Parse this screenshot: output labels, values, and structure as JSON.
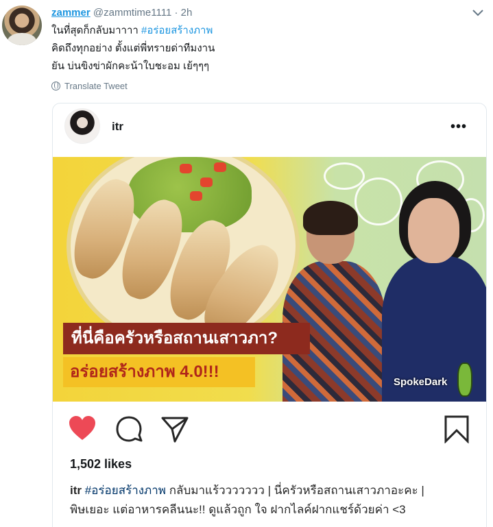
{
  "tweet": {
    "display_name": "zammer",
    "handle": "@zammtime1111",
    "separator": "·",
    "time": "2h",
    "line1_text": "ในที่สุดก็กลับมาาาา ",
    "line1_hashtag": "#อร่อยสร้างภาพ",
    "line2": "คิดถึงทุกอย่าง ตั้งแต่พี่ทรายด่าทีมงาน",
    "line3": "ยัน บ่นขิงข่าผักคะน้าใบชะอม เย้ๆๆๆ",
    "translate_label": "Translate Tweet"
  },
  "embed": {
    "username": "itr",
    "more_label": "•••",
    "image_banner_line1": "ที่นี่คือครัวหรือสถานเสาวภา?",
    "image_banner_line2": "อร่อยสร้างภาพ 4.0!!!",
    "image_brand": "SpokeDark",
    "likes": "1,502 likes",
    "caption_user": "itr",
    "caption_hashtag": "#อร่อยสร้างภาพ",
    "caption_line1_rest": " กลับมาแร้ววววววว | นี่ครัวหรือสถานเสาวภาอะคะ |",
    "caption_line2": "พิษเยอะ แต่อาหารคลีนนะ!! ดูแล้วถูก ใจ ฝากไลค์ฝากแชร์ด้วยค่า <3"
  },
  "colors": {
    "link": "#1b95e0",
    "like_heart": "#ed4956"
  },
  "icons": [
    "chevron-down-icon",
    "globe-icon",
    "more-icon",
    "heart-icon",
    "comment-icon",
    "share-icon",
    "bookmark-icon"
  ]
}
